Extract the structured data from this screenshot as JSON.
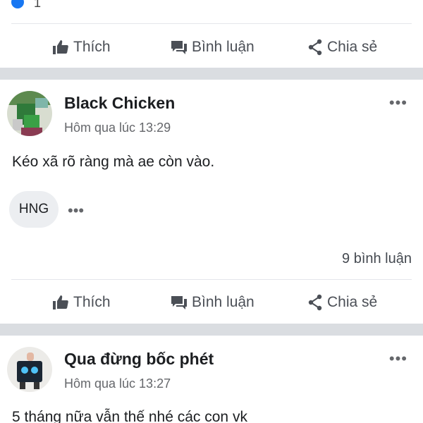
{
  "top_fragment": {
    "reaction_count": "1"
  },
  "action_bar": {
    "like_label": "Thích",
    "comment_label": "Bình luận",
    "share_label": "Chia sẻ"
  },
  "posts": [
    {
      "author": "Black Chicken",
      "timestamp": "Hôm qua lúc 13:29",
      "text": "Kéo xã rõ ràng mà ae còn vào.",
      "tag_chip": "HNG",
      "chip_more": "•••",
      "comment_count": "9 bình luận",
      "more_menu": "•••"
    },
    {
      "author": "Qua đừng bốc phét",
      "timestamp": "Hôm qua lúc 13:27",
      "text": "5 tháng nữa vẫn thế nhé các con vk",
      "more_menu": "•••"
    }
  ],
  "colors": {
    "accent": "#1877f2",
    "separator": "#dadde1",
    "text_muted": "#65676b"
  }
}
